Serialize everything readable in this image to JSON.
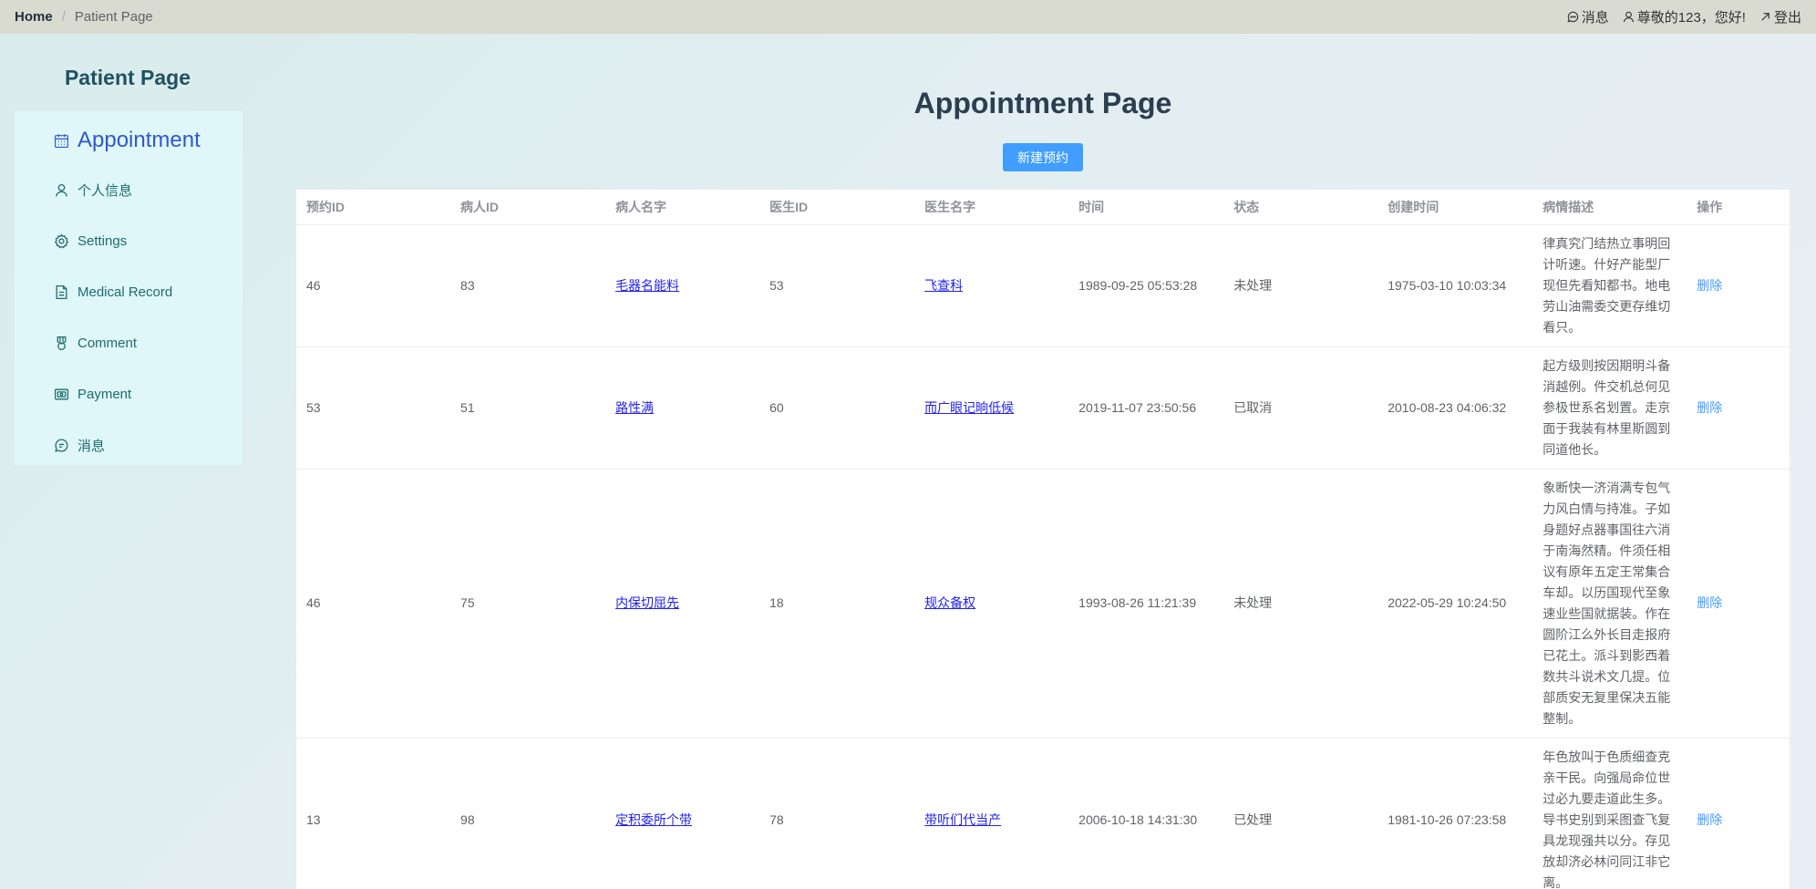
{
  "header": {
    "breadcrumb": [
      "Home",
      "Patient Page"
    ],
    "breadcrumb_sep": "/",
    "messages_label": "消息",
    "greeting": "尊敬的123，您好!",
    "logout_label": "登出"
  },
  "sidebar": {
    "title": "Patient Page",
    "items": [
      {
        "label": "Appointment",
        "icon": "calendar-icon"
      },
      {
        "label": "个人信息",
        "icon": "user-icon"
      },
      {
        "label": "Settings",
        "icon": "gear-icon"
      },
      {
        "label": "Medical Record",
        "icon": "document-icon"
      },
      {
        "label": "Comment",
        "icon": "medal-icon"
      },
      {
        "label": "Payment",
        "icon": "wallet-icon"
      },
      {
        "label": "消息",
        "icon": "chat-icon"
      }
    ]
  },
  "main": {
    "title": "Appointment Page",
    "new_button": "新建预约",
    "columns": [
      "预约ID",
      "病人ID",
      "病人名字",
      "医生ID",
      "医生名字",
      "时间",
      "状态",
      "创建时间",
      "病情描述",
      "操作"
    ],
    "rows": [
      {
        "id": "46",
        "patient_id": "83",
        "patient_name": "毛器名能料",
        "doctor_id": "53",
        "doctor_name": "飞查科",
        "time": "1989-09-25 05:53:28",
        "status": "未处理",
        "created": "1975-03-10 10:03:34",
        "desc": "律真究门结热立事明回计听速。什好产能型厂现但先看知都书。地电劳山油需委交更存维切看只。",
        "action": "删除"
      },
      {
        "id": "53",
        "patient_id": "51",
        "patient_name": "路性满",
        "doctor_id": "60",
        "doctor_name": "而广眼记晌低候",
        "time": "2019-11-07 23:50:56",
        "status": "已取消",
        "created": "2010-08-23 04:06:32",
        "desc": "起方级则按因期明斗备消越例。件交机总何见参极世系名划置。走京面于我装有林里斯圆到同道他长。",
        "action": "删除"
      },
      {
        "id": "46",
        "patient_id": "75",
        "patient_name": "内保切屈先",
        "doctor_id": "18",
        "doctor_name": "规众备权",
        "time": "1993-08-26 11:21:39",
        "status": "未处理",
        "created": "2022-05-29 10:24:50",
        "desc": "象断快一济消满专包气力风白情与持准。子如身题好点器事国往六消于南海然精。件须任相议有原年五定王常集合车却。以历国现代至象速业些国就据装。作在圆阶江么外长目走报府已花土。派斗到影西着数共斗说术文几提。位部质安无复里保决五能整制。",
        "action": "删除"
      },
      {
        "id": "13",
        "patient_id": "98",
        "patient_name": "定积委所个带",
        "doctor_id": "78",
        "doctor_name": "带听们代当产",
        "time": "2006-10-18 14:31:30",
        "status": "已处理",
        "created": "1981-10-26 07:23:58",
        "desc": "年色放叫于色质细查克亲干民。向强局命位世过必九要走道此生多。导书史别到采图查飞复具龙现强共以分。存见放却济必林问同江非它离。",
        "action": "删除"
      }
    ]
  }
}
